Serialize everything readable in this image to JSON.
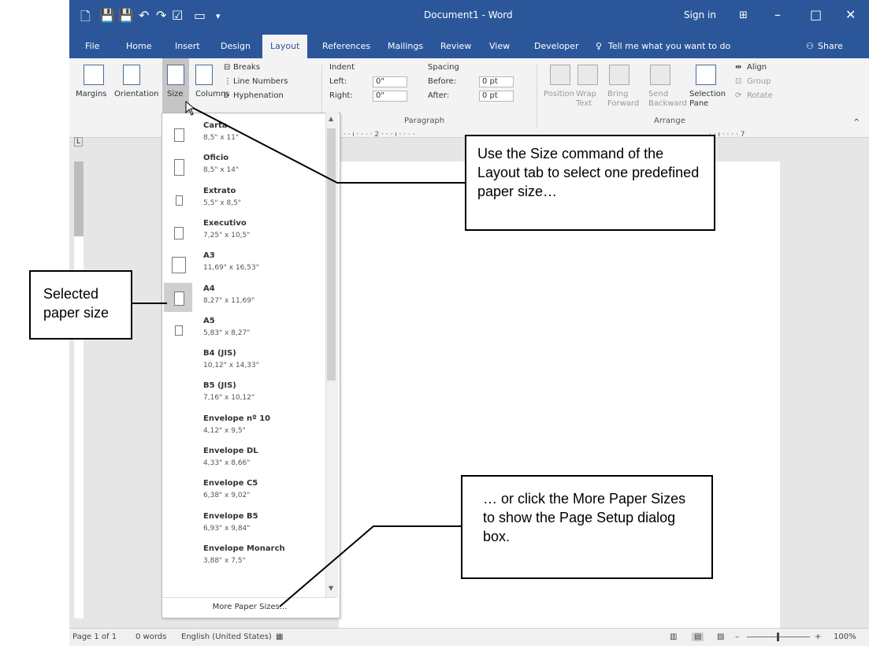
{
  "window": {
    "title": "Document1  -  Word",
    "sign_in": "Sign in",
    "minimize": "–",
    "maximize": "□",
    "close": "✕",
    "quick_access": [
      "🗋",
      "💾",
      "💾",
      "↶",
      "↷",
      "☑",
      "▭",
      "▾"
    ]
  },
  "tabs": [
    "File",
    "Home",
    "Insert",
    "Design",
    "Layout",
    "References",
    "Mailings",
    "Review",
    "View",
    "Developer"
  ],
  "active_tab": "Layout",
  "tell_me": "Tell me what you want to do",
  "share": "Share",
  "ribbon": {
    "margins": "Margins",
    "orientation": "Orientation",
    "size": "Size",
    "columns": "Columns",
    "breaks": "Breaks",
    "line_numbers": "Line Numbers",
    "hyphenation": "Hyphenation",
    "indent_label": "Indent",
    "spacing_label": "Spacing",
    "left_label": "Left:",
    "right_label": "Right:",
    "left_value": "0\"",
    "right_value": "0\"",
    "before_label": "Before:",
    "after_label": "After:",
    "before_value": "0 pt",
    "after_value": "0 pt",
    "paragraph_group": "Paragraph",
    "position": "Position",
    "wrap_text": "Wrap\nText",
    "bring_forward": "Bring\nForward",
    "send_backward": "Send\nBackward",
    "selection_pane": "Selection\nPane",
    "align": "Align",
    "group": "Group",
    "rotate": "Rotate",
    "arrange_group": "Arrange"
  },
  "ruler": {
    "tab_marker": "L",
    "h_marks": "·  ·  ·  ı  ·  ·  ·  ·  2  ·  ·  ·  ı  ·  ·  ·  ·",
    "h_marks_right": "·  ·  ı  ·  ·  ·  ·  7"
  },
  "dropdown": {
    "items": [
      {
        "name": "Carta",
        "dims": "8,5\" x 11\"",
        "w": 8.5,
        "h": 11
      },
      {
        "name": "Oficio",
        "dims": "8,5\" x 14\"",
        "w": 8.5,
        "h": 14
      },
      {
        "name": "Extrato",
        "dims": "5,5\" x 8,5\"",
        "w": 5.5,
        "h": 8.5
      },
      {
        "name": "Executivo",
        "dims": "7,25\" x 10,5\"",
        "w": 7.25,
        "h": 10.5
      },
      {
        "name": "A3",
        "dims": "11,69\" x 16,53\"",
        "w": 11.69,
        "h": 16.53
      },
      {
        "name": "A4",
        "dims": "8,27\" x 11,69\"",
        "w": 8.27,
        "h": 11.69
      },
      {
        "name": "A5",
        "dims": "5,83\" x 8,27\"",
        "w": 5.83,
        "h": 8.27
      },
      {
        "name": "B4 (JIS)",
        "dims": "10,12\" x 14,33\"",
        "w": 10.12,
        "h": 14.33
      },
      {
        "name": "B5 (JIS)",
        "dims": "7,16\" x 10,12\"",
        "w": 7.16,
        "h": 10.12
      },
      {
        "name": "Envelope nº 10",
        "dims": "4,12\" x 9,5\"",
        "w": 4.12,
        "h": 9.5
      },
      {
        "name": "Envelope DL",
        "dims": "4,33\" x 8,66\"",
        "w": 4.33,
        "h": 8.66
      },
      {
        "name": "Envelope C5",
        "dims": "6,38\" x 9,02\"",
        "w": 6.38,
        "h": 9.02
      },
      {
        "name": "Envelope B5",
        "dims": "6,93\" x 9,84\"",
        "w": 6.93,
        "h": 9.84
      },
      {
        "name": "Envelope Monarch",
        "dims": "3,88\" x 7,5\"",
        "w": 3.88,
        "h": 7.5
      }
    ],
    "selected": "A4",
    "more_paper_sizes": "More Paper Sizes..."
  },
  "callouts": {
    "size_command": "Use the Size command of the Layout tab to select one predefined paper size…",
    "more_paper_sizes": "… or click the More Paper Sizes to show the Page Setup dialog box.",
    "selected_paper_size": "Selected paper size"
  },
  "status_bar": {
    "page": "Page 1 of 1",
    "words": "0 words",
    "language": "English (United States)",
    "zoom": "100%"
  },
  "colors": {
    "word_blue": "#2b579a",
    "ribbon_bg": "#f3f3f3",
    "selected_item": "#cfcfcf"
  }
}
